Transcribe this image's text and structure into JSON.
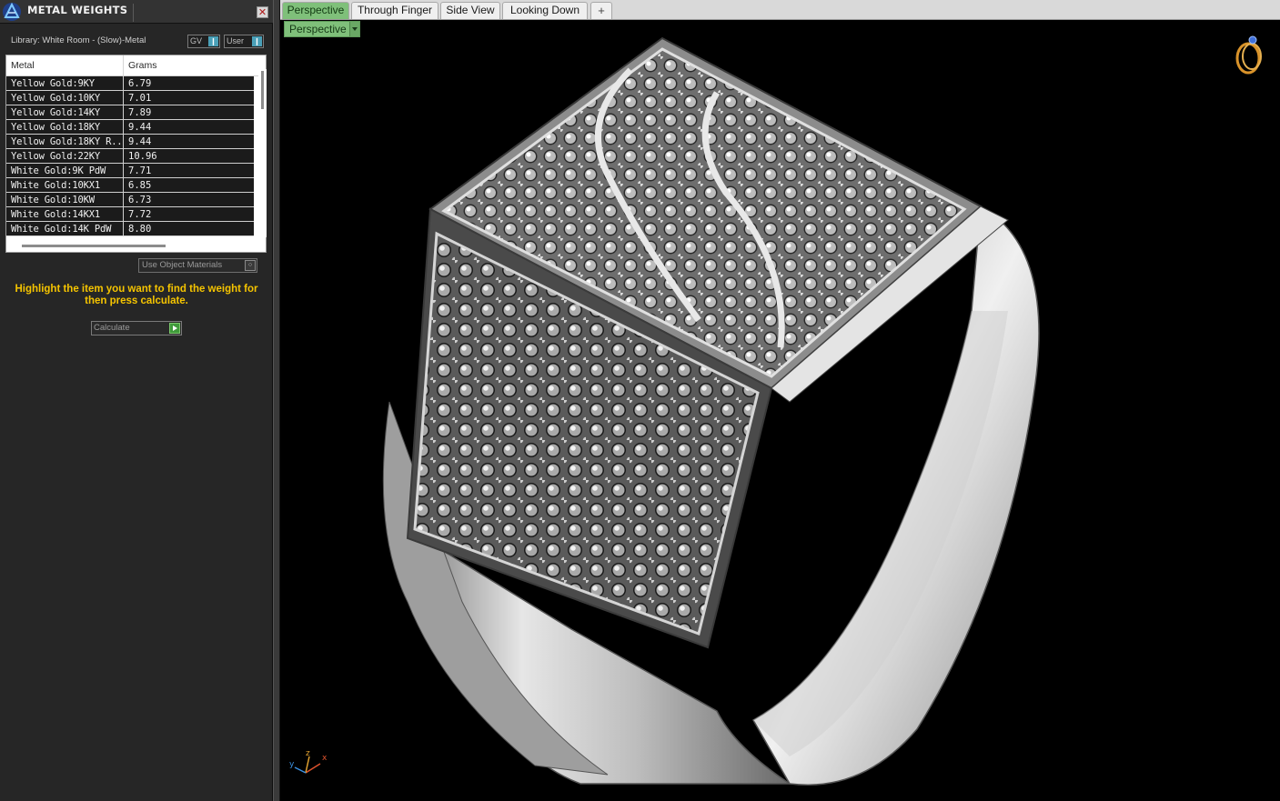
{
  "panel": {
    "title": "METAL WEIGHTS",
    "close_glyph": "✕",
    "library_label": "Library: White Room - (Slow)-Metal",
    "gv_label": "GV",
    "user_label": "User",
    "table": {
      "columns": [
        "Metal",
        "Grams"
      ],
      "rows": [
        {
          "metal": "Yellow Gold:9KY",
          "grams": "6.79"
        },
        {
          "metal": "Yellow Gold:10KY",
          "grams": "7.01"
        },
        {
          "metal": "Yellow Gold:14KY",
          "grams": "7.89"
        },
        {
          "metal": "Yellow Gold:18KY",
          "grams": "9.44"
        },
        {
          "metal": "Yellow Gold:18KY R...",
          "grams": "9.44"
        },
        {
          "metal": "Yellow Gold:22KY",
          "grams": "10.96"
        },
        {
          "metal": "White Gold:9K PdW",
          "grams": "7.71"
        },
        {
          "metal": "White Gold:10KX1",
          "grams": "6.85"
        },
        {
          "metal": "White Gold:10KW",
          "grams": "6.73"
        },
        {
          "metal": "White Gold:14KX1",
          "grams": "7.72"
        },
        {
          "metal": "White Gold:14K PdW",
          "grams": "8.80"
        }
      ]
    },
    "use_object_materials": "Use Object Materials",
    "instructions": "Highlight the item you want to find the weight for then press calculate.",
    "calculate_label": "Calculate"
  },
  "viewport": {
    "tabs": [
      {
        "label": "Perspective",
        "active": true
      },
      {
        "label": "Through Finger",
        "active": false
      },
      {
        "label": "Side View",
        "active": false
      },
      {
        "label": "Looking Down",
        "active": false
      }
    ],
    "add_tab_glyph": "+",
    "view_dropdown": "Perspective",
    "axis": {
      "x": "x",
      "y": "y",
      "z": "z"
    },
    "colors": {
      "active_tab": "#7fc07a",
      "background": "#000000",
      "metal": "#c8c8c8",
      "accent_text": "#f5c400"
    }
  },
  "icons": [
    "app-logo-icon",
    "close-icon",
    "ring-view-icon",
    "axis-gizmo-icon",
    "dropdown-arrow-icon",
    "play-icon"
  ]
}
